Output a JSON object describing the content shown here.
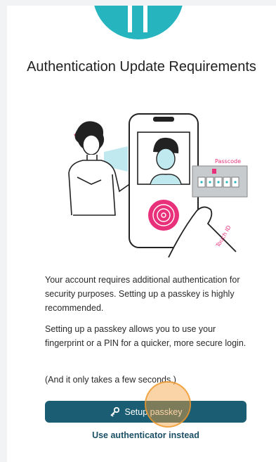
{
  "title": "Authentication Update Requirements",
  "illustration": {
    "face_id_label": "Face ID",
    "passcode_label": "Passcode",
    "touch_id_label": "Touch ID"
  },
  "paragraphs": {
    "p1": "Your account requires additional authentication for security purposes. Setting up a passkey is highly recommended.",
    "p2": "Setting up a passkey allows you to use your fingerprint or a PIN for a quicker, more secure login.",
    "p3": "(And it only takes a few seconds.)"
  },
  "actions": {
    "setup_label": "Setup passkey",
    "setup_icon": "key-icon",
    "alt_label": "Use authenticator instead"
  },
  "colors": {
    "brand": "#26b5bf",
    "button": "#1b5d73",
    "link": "#1b4f66",
    "fingerprint": "#e8317a"
  }
}
